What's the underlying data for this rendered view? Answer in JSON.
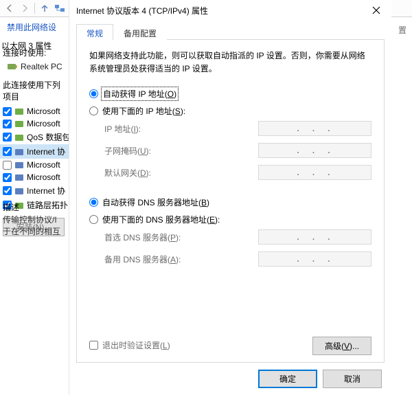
{
  "bg": {
    "disable_link": "禁用此网络设",
    "eth_prop_title": "以太网 3 属性",
    "organize": "置",
    "section_conn": "连接时使用:",
    "adapter": "Realtek PC",
    "section_items": "此连接使用下列项目",
    "items": [
      {
        "checked": true,
        "label": "Microsoft",
        "sel": false,
        "color": "#6fae46"
      },
      {
        "checked": true,
        "label": "Microsoft",
        "sel": false,
        "color": "#6fae46"
      },
      {
        "checked": true,
        "label": "QoS 数据包",
        "sel": false,
        "color": "#6fae46"
      },
      {
        "checked": true,
        "label": "Internet 协",
        "sel": true,
        "color": "#5a7fbf"
      },
      {
        "checked": false,
        "label": "Microsoft",
        "sel": false,
        "color": "#5a7fbf"
      },
      {
        "checked": true,
        "label": "Microsoft",
        "sel": false,
        "color": "#5a7fbf"
      },
      {
        "checked": true,
        "label": "Internet 协",
        "sel": false,
        "color": "#5a7fbf"
      },
      {
        "checked": true,
        "label": "链路层拓扑",
        "sel": false,
        "color": "#6fae46"
      }
    ],
    "install_btn": "安装(N)...",
    "desc_title": "描述",
    "desc_body1": "传输控制协议/I",
    "desc_body2": "于在不同的相互"
  },
  "dlg": {
    "title": "Internet 协议版本 4 (TCP/IPv4) 属性",
    "tabs": {
      "general": "常规",
      "alt": "备用配置"
    },
    "description": "如果网络支持此功能，则可以获取自动指派的 IP 设置。否则，你需要从网络系统管理员处获得适当的 IP 设置。",
    "ip": {
      "auto_label_pre": "自动获得 IP 地址(",
      "auto_key": "O",
      "auto_label_post": ")",
      "manual_label_pre": "使用下面的 IP 地址(",
      "manual_key": "S",
      "manual_label_post": "):",
      "fields": {
        "ip": {
          "label_pre": "IP 地址(",
          "key": "I",
          "label_post": "):"
        },
        "mask": {
          "label_pre": "子网掩码(",
          "key": "U",
          "label_post": "):"
        },
        "gw": {
          "label_pre": "默认网关(",
          "key": "D",
          "label_post": "):"
        }
      }
    },
    "dns": {
      "auto_label_pre": "自动获得 DNS 服务器地址(",
      "auto_key": "B",
      "auto_label_post": ")",
      "manual_label_pre": "使用下面的 DNS 服务器地址(",
      "manual_key": "E",
      "manual_label_post": "):",
      "fields": {
        "pref": {
          "label_pre": "首选 DNS 服务器(",
          "key": "P",
          "label_post": "):"
        },
        "alt": {
          "label_pre": "备用 DNS 服务器(",
          "key": "A",
          "label_post": "):"
        }
      }
    },
    "validate": {
      "pre": "退出时验证设置(",
      "key": "L",
      "post": ")"
    },
    "advanced": {
      "pre": "高级(",
      "key": "V",
      "post": ")..."
    },
    "ok": "确定",
    "cancel": "取消",
    "ip_dots": ". . ."
  }
}
